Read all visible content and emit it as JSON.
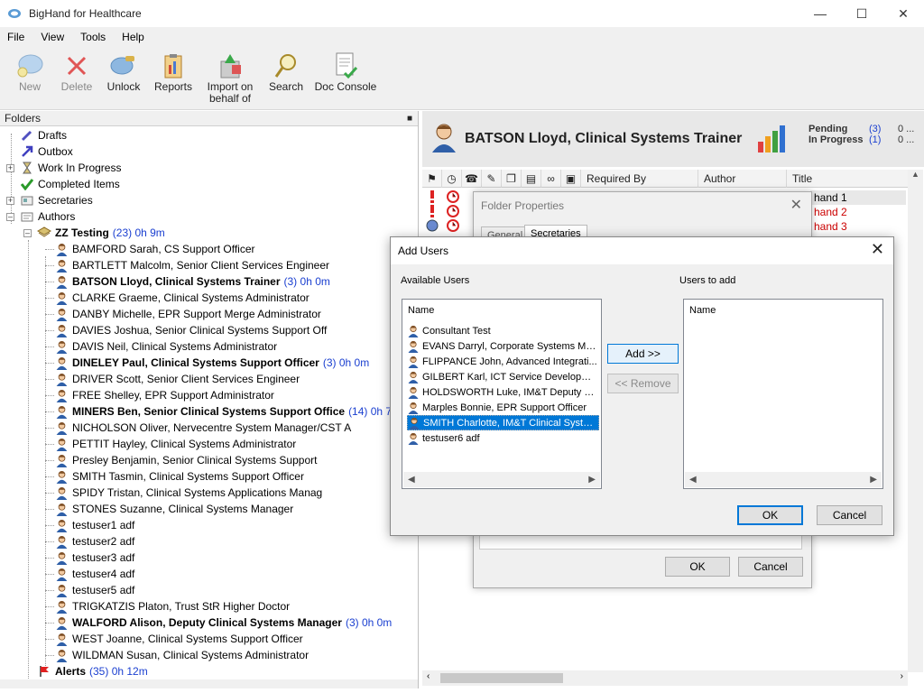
{
  "window": {
    "title": "BigHand for Healthcare"
  },
  "menu": [
    "File",
    "View",
    "Tools",
    "Help"
  ],
  "toolbar": {
    "new": "New",
    "delete": "Delete",
    "unlock": "Unlock",
    "reports": "Reports",
    "import_line1": "Import on",
    "import_line2": "behalf of",
    "search": "Search",
    "doc_console": "Doc Console"
  },
  "folders": {
    "header": "Folders",
    "drafts": "Drafts",
    "outbox": "Outbox",
    "wip": "Work In Progress",
    "completed": "Completed Items",
    "secretaries": "Secretaries",
    "authors": "Authors",
    "group": {
      "name": "ZZ Testing",
      "count": "(23) 0h 9m"
    },
    "alerts": {
      "name": "Alerts",
      "count": "(35) 0h 12m"
    },
    "authors_list": [
      {
        "name": "BAMFORD Sarah, CS Support Officer",
        "count": ""
      },
      {
        "name": "BARTLETT Malcolm, Senior Client Services Engineer",
        "count": ""
      },
      {
        "name": "BATSON Lloyd, Clinical Systems Trainer",
        "count": "(3) 0h 0m"
      },
      {
        "name": "CLARKE Graeme, Clinical Systems Administrator",
        "count": ""
      },
      {
        "name": "DANBY Michelle, EPR Support Merge Administrator",
        "count": ""
      },
      {
        "name": "DAVIES Joshua, Senior Clinical Systems Support Off",
        "count": ""
      },
      {
        "name": "DAVIS Neil, Clinical Systems Administrator",
        "count": ""
      },
      {
        "name": "DINELEY Paul, Clinical Systems Support Officer",
        "count": "(3) 0h 0m"
      },
      {
        "name": "DRIVER Scott, Senior Client Services Engineer",
        "count": ""
      },
      {
        "name": "FREE Shelley, EPR Support Administrator",
        "count": ""
      },
      {
        "name": "MINERS Ben, Senior Clinical Systems Support Office",
        "count": "(14) 0h 7m"
      },
      {
        "name": "NICHOLSON Oliver, Nervecentre System Manager/CST A",
        "count": ""
      },
      {
        "name": "PETTIT Hayley, Clinical Systems Administrator",
        "count": ""
      },
      {
        "name": "Presley Benjamin, Senior Clinical Systems Support",
        "count": ""
      },
      {
        "name": "SMITH Tasmin, Clinical Systems Support Officer",
        "count": ""
      },
      {
        "name": "SPIDY Tristan, Clinical Systems Applications Manag",
        "count": ""
      },
      {
        "name": "STONES Suzanne, Clinical Systems Manager",
        "count": ""
      },
      {
        "name": "testuser1 adf",
        "count": ""
      },
      {
        "name": "testuser2 adf",
        "count": ""
      },
      {
        "name": "testuser3 adf",
        "count": ""
      },
      {
        "name": "testuser4 adf",
        "count": ""
      },
      {
        "name": "testuser5 adf",
        "count": ""
      },
      {
        "name": "TRIGKATZIS Platon, Trust StR Higher Doctor",
        "count": ""
      },
      {
        "name": "WALFORD Alison, Deputy Clinical Systems Manager",
        "count": "(3) 0h 0m"
      },
      {
        "name": "WEST Joanne, Clinical Systems Support Officer",
        "count": ""
      },
      {
        "name": "WILDMAN Susan, Clinical Systems Administrator",
        "count": ""
      }
    ]
  },
  "author_panel": {
    "name": "BATSON Lloyd, Clinical Systems Trainer",
    "pending_label": "Pending",
    "pending_value": "(3)",
    "pending_extra": "0 ...",
    "inprogress_label": "In Progress",
    "inprogress_value": "(1)",
    "inprogress_extra": "0 ...",
    "columns": {
      "required_by": "Required By",
      "author": "Author",
      "title": "Title"
    },
    "rows": [
      "hand 1",
      "hand 2",
      "hand 3"
    ]
  },
  "folder_properties": {
    "title": "Folder Properties",
    "tab_general": "General",
    "tab_secretaries": "Secretaries",
    "ok": "OK",
    "cancel": "Cancel"
  },
  "add_users": {
    "title": "Add Users",
    "available_label": "Available Users",
    "to_add_label": "Users to add",
    "name_header": "Name",
    "to_add_header": "Name",
    "available": [
      "Consultant Test",
      "EVANS Darryl, Corporate Systems Ma...",
      "FLIPPANCE John, Advanced Integrati...",
      "GILBERT Karl, ICT Service Developme...",
      "HOLDSWORTH Luke, IM&T Deputy De...",
      "Marples Bonnie, EPR Support Officer",
      "SMITH Charlotte, IM&T Clinical System...",
      "testuser6 adf"
    ],
    "selected_index": 6,
    "add_button": "Add >>",
    "remove_button": "<< Remove",
    "ok": "OK",
    "cancel": "Cancel"
  }
}
